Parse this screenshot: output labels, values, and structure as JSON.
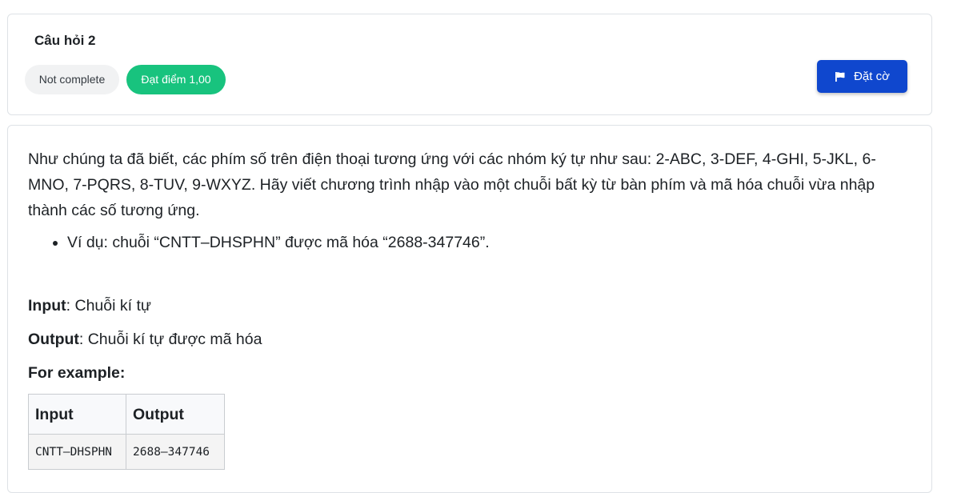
{
  "question_info": {
    "title": "Câu hỏi 2",
    "state": "Not complete",
    "grade": "Đạt điểm 1,00",
    "flag_label": "Đặt cờ",
    "flag_icon": "flag-icon"
  },
  "question_text": {
    "intro": "Như chúng ta đã biết, các phím số trên điện thoại tương ứng với các nhóm ký tự như sau: 2-ABC, 3-DEF, 4-GHI, 5-JKL, 6-MNO, 7-PQRS, 8-TUV, 9-WXYZ. Hãy viết chương trình nhập vào một chuỗi bất kỳ từ bàn phím và mã hóa chuỗi vừa nhập thành các số tương ứng.",
    "bullet": "Ví dụ: chuỗi “CNTT–DHSPHN” được mã hóa “2688-347746”.",
    "input_label": "Input",
    "input_desc": ": Chuỗi kí tự",
    "output_label": "Output",
    "output_desc": ": Chuỗi kí tự được mã hóa",
    "example_heading": "For example:"
  },
  "example_table": {
    "headers": [
      "Input",
      "Output"
    ],
    "rows": [
      [
        "CNTT–DHSPHN",
        "2688–347746"
      ]
    ]
  },
  "colors": {
    "grade_badge": "#18c37e",
    "flag_button": "#0f47ce",
    "state_badge": "#f1f2f3"
  }
}
